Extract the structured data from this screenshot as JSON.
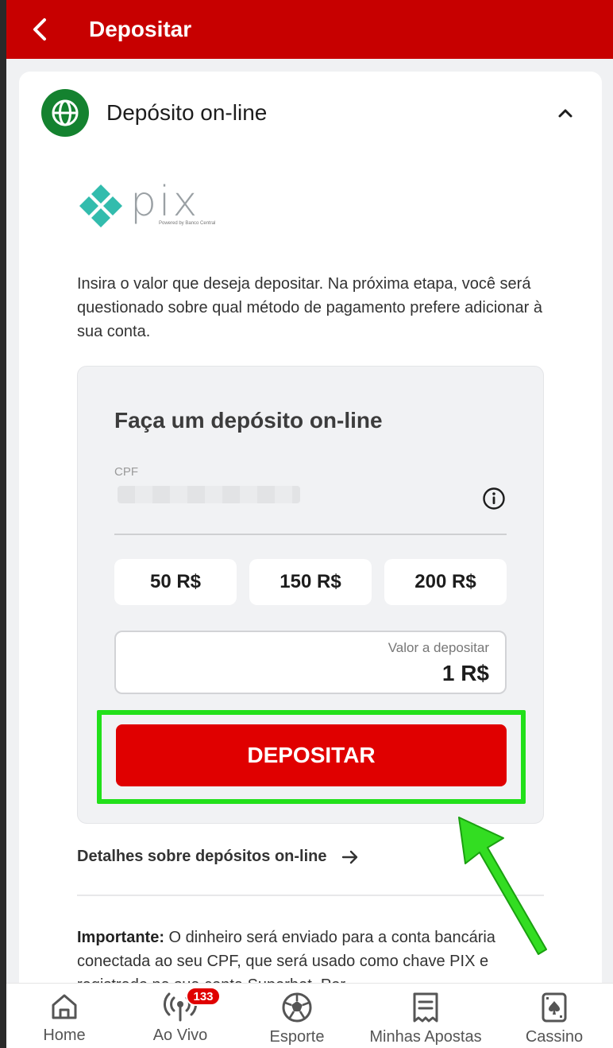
{
  "header": {
    "title": "Depositar"
  },
  "section": {
    "title": "Depósito on-line"
  },
  "pix": {
    "wordmark": "pix",
    "subtitle": "Powered by Banco Central"
  },
  "intro_text": "Insira o valor que deseja depositar. Na próxima etapa, você será questionado sobre qual método de pagamento prefere adicionar à sua conta.",
  "form": {
    "title": "Faça um depósito on-line",
    "cpf_label": "CPF",
    "amounts": [
      "50 R$",
      "150 R$",
      "200 R$"
    ],
    "value_label": "Valor a depositar",
    "value": "1 R$",
    "submit_label": "DEPOSITAR"
  },
  "details_link": "Detalhes sobre depósitos on-line",
  "important": {
    "label": "Importante:",
    "text": " O dinheiro será enviado para a conta bancária conectada ao seu CPF, que será usado como chave PIX e registrado na sua conta Superbet. Por"
  },
  "nav": {
    "items": [
      {
        "label": "Home",
        "icon": "home-icon"
      },
      {
        "label": "Ao Vivo",
        "icon": "live-broadcast-icon",
        "badge": "133"
      },
      {
        "label": "Esporte",
        "icon": "soccer-ball-icon"
      },
      {
        "label": "Minhas Apostas",
        "icon": "bet-slip-icon"
      },
      {
        "label": "Cassino",
        "icon": "playing-card-icon"
      }
    ]
  },
  "colors": {
    "header": "#c70000",
    "button": "#e00000",
    "highlight": "#22e01a",
    "globe": "#14822f",
    "pix": "#32bcad"
  }
}
